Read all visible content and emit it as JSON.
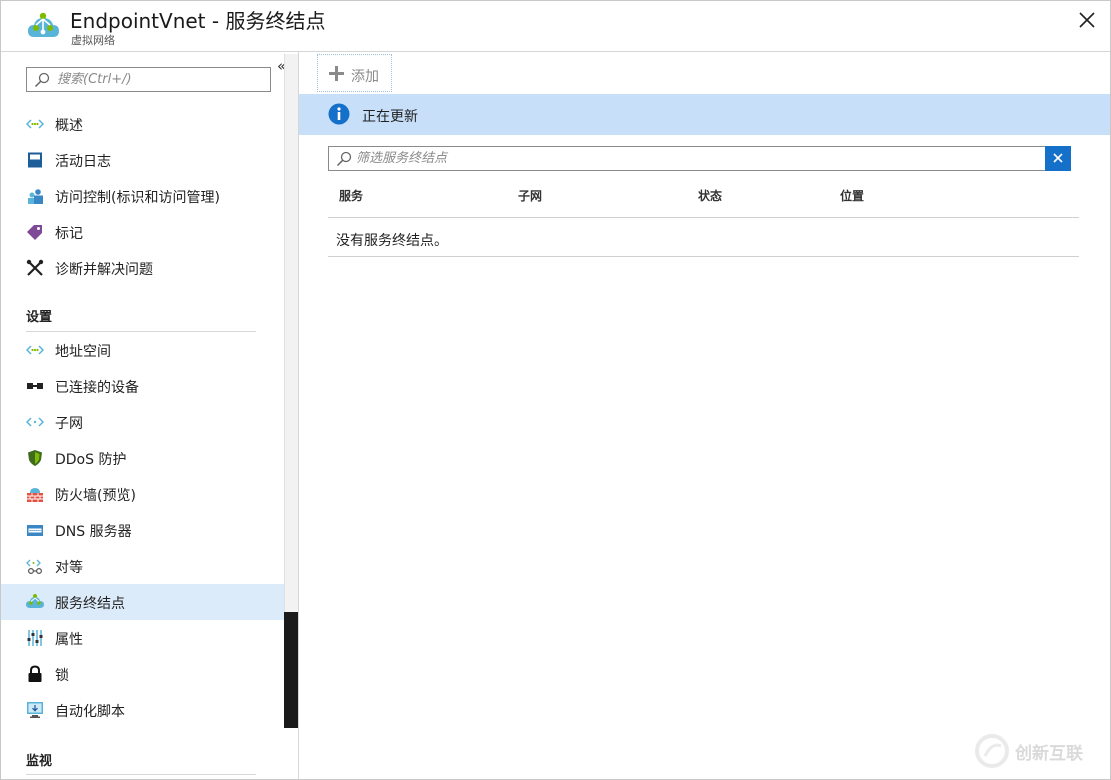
{
  "header": {
    "title": "EndpointVnet - 服务终结点",
    "subtitle": "虚拟网络",
    "close_icon": "close-icon"
  },
  "sidebar": {
    "search_placeholder": "搜索(Ctrl+/)",
    "collapse_glyph": "«",
    "items": [
      {
        "label": "概述",
        "icon": "vnet-overview-icon"
      },
      {
        "label": "活动日志",
        "icon": "activity-log-icon"
      },
      {
        "label": "访问控制(标识和访问管理)",
        "icon": "access-control-icon"
      },
      {
        "label": "标记",
        "icon": "tag-icon"
      },
      {
        "label": "诊断并解决问题",
        "icon": "wrench-icon"
      }
    ],
    "settings_header": "设置",
    "settings_items": [
      {
        "label": "地址空间",
        "icon": "address-space-icon"
      },
      {
        "label": "已连接的设备",
        "icon": "connected-devices-icon"
      },
      {
        "label": "子网",
        "icon": "subnet-icon"
      },
      {
        "label": "DDoS 防护",
        "icon": "ddos-shield-icon"
      },
      {
        "label": "防火墙(预览)",
        "icon": "firewall-icon"
      },
      {
        "label": "DNS 服务器",
        "icon": "dns-icon"
      },
      {
        "label": "对等",
        "icon": "peering-icon"
      },
      {
        "label": "服务终结点",
        "icon": "service-endpoint-icon",
        "active": true
      },
      {
        "label": "属性",
        "icon": "properties-icon"
      },
      {
        "label": "锁",
        "icon": "lock-icon"
      },
      {
        "label": "自动化脚本",
        "icon": "automation-script-icon"
      }
    ],
    "monitor_header": "监视"
  },
  "toolbar": {
    "add_label": "添加"
  },
  "banner": {
    "text": "正在更新",
    "icon": "info-icon"
  },
  "filter": {
    "placeholder": "筛选服务终结点"
  },
  "table": {
    "columns": [
      "服务",
      "子网",
      "状态",
      "位置"
    ],
    "empty_message": "没有服务终结点。"
  },
  "watermark": {
    "text": "创新互联"
  },
  "colors": {
    "accent": "#1570c9",
    "banner": "#c7dff8",
    "active_item": "#dcebf9"
  }
}
